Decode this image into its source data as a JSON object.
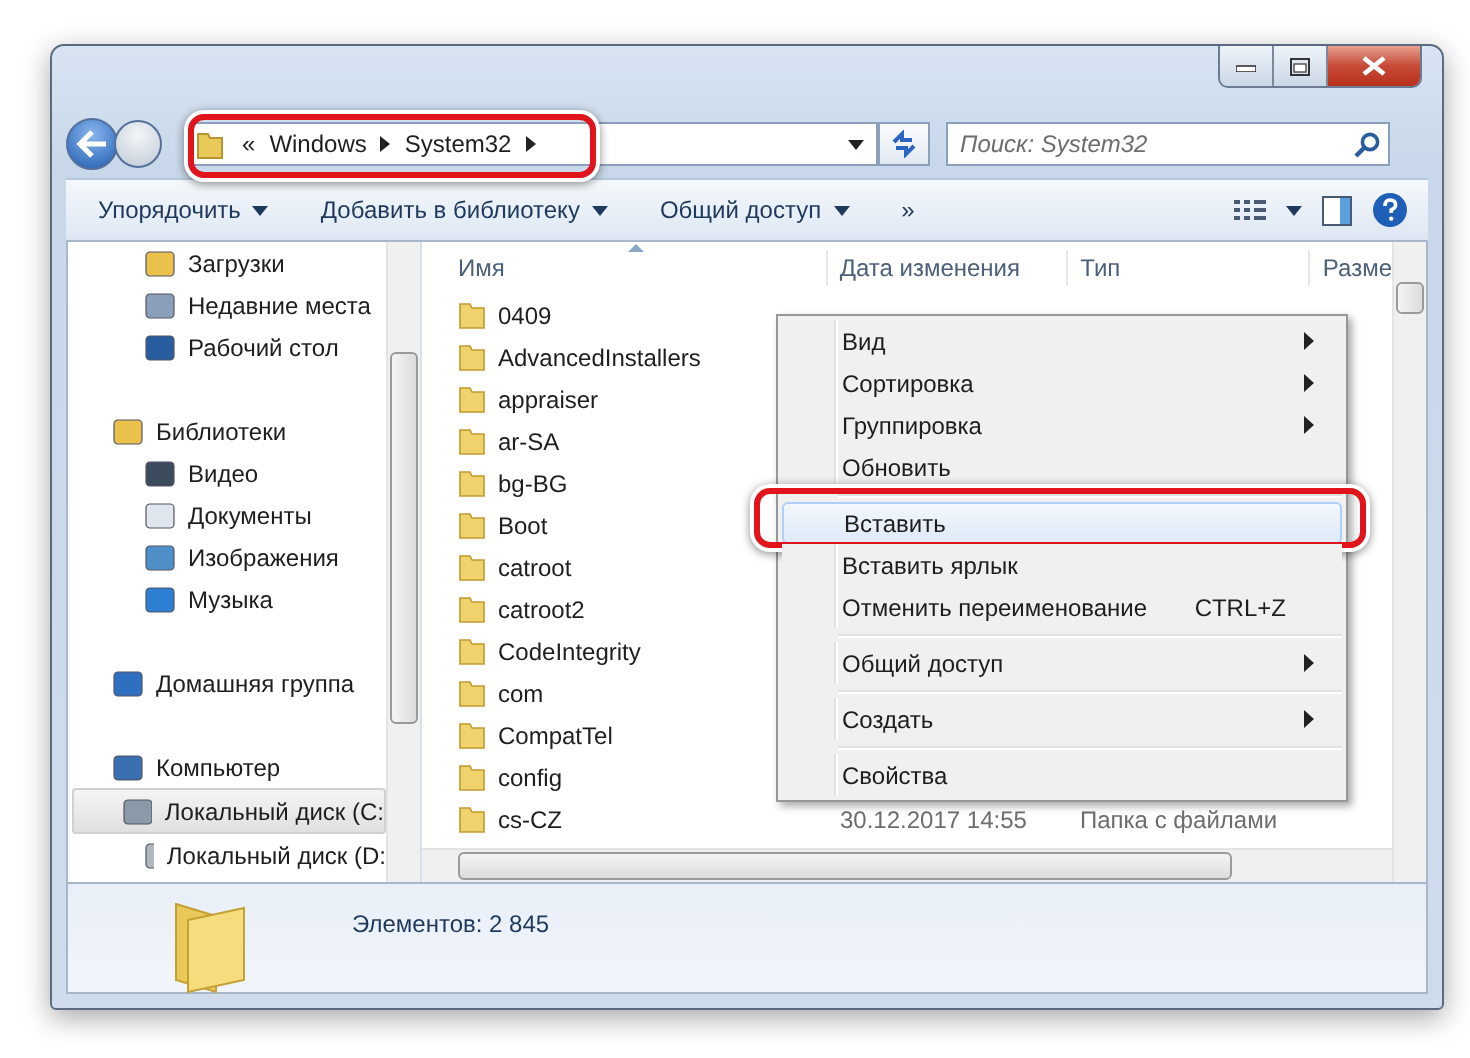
{
  "address": {
    "prefix": "«",
    "segments": [
      "Windows",
      "System32"
    ]
  },
  "search": {
    "placeholder": "Поиск: System32"
  },
  "toolbar": {
    "buttons": [
      {
        "label": "Упорядочить",
        "dropdown": true
      },
      {
        "label": "Добавить в библиотеку",
        "dropdown": true
      },
      {
        "label": "Общий доступ",
        "dropdown": true
      },
      {
        "label": "»",
        "dropdown": false
      }
    ]
  },
  "sidebar": {
    "items": [
      {
        "children": [
          {
            "label": "Загрузки",
            "selected": false
          },
          {
            "label": "Недавние места",
            "selected": false
          },
          {
            "label": "Рабочий стол",
            "selected": false
          }
        ]
      },
      {
        "label": "Библиотеки",
        "selected": false,
        "children": [
          {
            "label": "Видео",
            "selected": false
          },
          {
            "label": "Документы",
            "selected": false
          },
          {
            "label": "Изображения",
            "selected": false
          },
          {
            "label": "Музыка",
            "selected": false
          }
        ]
      },
      {
        "label": "Домашняя группа",
        "selected": false
      },
      {
        "label": "Компьютер",
        "selected": false,
        "children": [
          {
            "label": "Локальный диск (C:",
            "selected": true
          },
          {
            "label": "Локальный диск (D:",
            "selected": false
          }
        ]
      }
    ]
  },
  "table": {
    "columns": [
      "Имя",
      "Дата изменения",
      "Тип",
      "Разме"
    ],
    "rows": [
      {
        "name": "0409"
      },
      {
        "name": "AdvancedInstallers"
      },
      {
        "name": "appraiser"
      },
      {
        "name": "ar-SA"
      },
      {
        "name": "bg-BG"
      },
      {
        "name": "Boot"
      },
      {
        "name": "catroot"
      },
      {
        "name": "catroot2"
      },
      {
        "name": "CodeIntegrity"
      },
      {
        "name": "com"
      },
      {
        "name": "CompatTel"
      },
      {
        "name": "config"
      },
      {
        "name": "cs-CZ",
        "date": "30.12.2017 14:55",
        "type": "Папка с файлами"
      }
    ]
  },
  "context_menu": {
    "groups": [
      [
        {
          "label": "Вид",
          "submenu": true,
          "selected": false
        },
        {
          "label": "Сортировка",
          "submenu": true,
          "selected": false
        },
        {
          "label": "Группировка",
          "submenu": true,
          "selected": false
        },
        {
          "label": "Обновить",
          "submenu": false,
          "selected": false
        }
      ],
      [
        {
          "label": "Вставить",
          "submenu": false,
          "selected": true
        },
        {
          "label": "Вставить ярлык",
          "submenu": false,
          "selected": false
        },
        {
          "label": "Отменить переименование",
          "shortcut": "CTRL+Z",
          "submenu": false,
          "selected": false
        }
      ],
      [
        {
          "label": "Общий доступ",
          "submenu": true,
          "selected": false
        }
      ],
      [
        {
          "label": "Создать",
          "submenu": true,
          "selected": false
        }
      ],
      [
        {
          "label": "Свойства",
          "submenu": false,
          "selected": false
        }
      ]
    ]
  },
  "status_bar": {
    "text": "Элементов: 2 845"
  }
}
